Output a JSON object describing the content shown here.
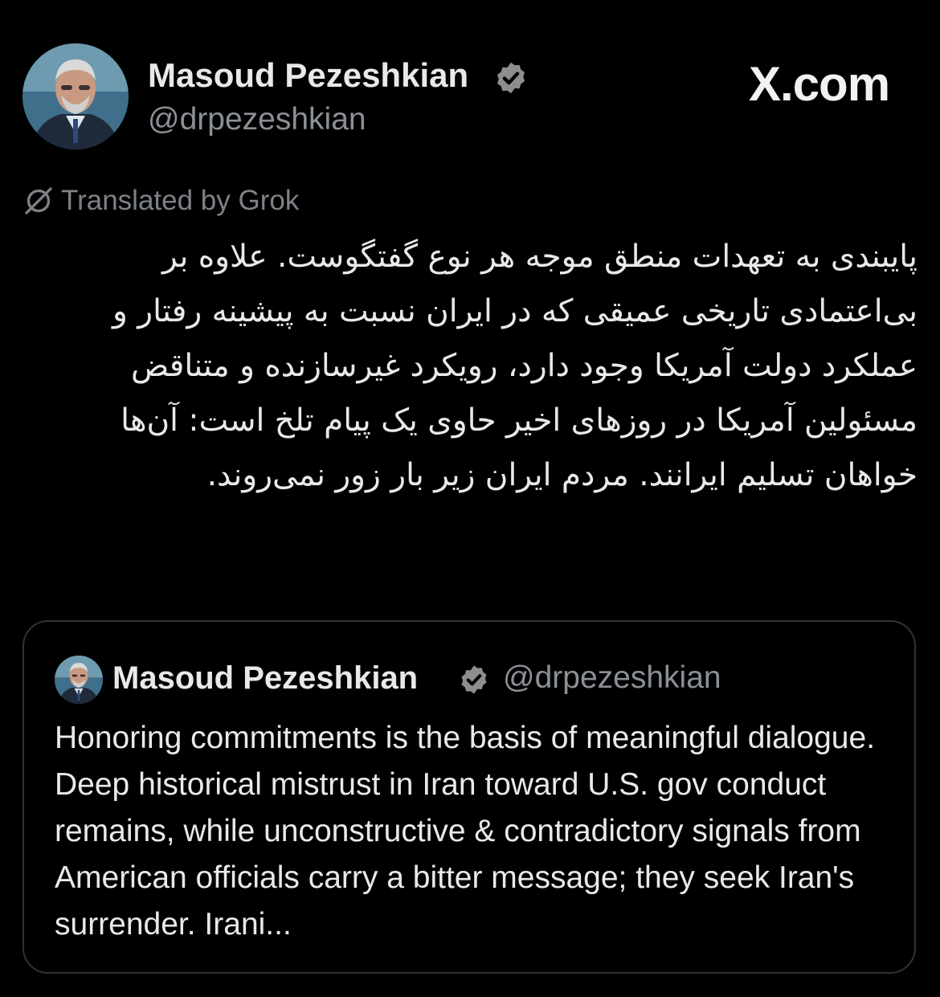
{
  "brand": {
    "label": "X.com"
  },
  "author": {
    "name": "Masoud Pezeshkian",
    "handle": "@drpezeshkian",
    "verified": true
  },
  "translation_note": "Translated by Grok",
  "tweet": {
    "text": "پایبندی به تعهدات منطق موجه هر نوع گفتگوست. علاوه بر بی‌اعتمادی تاریخی عمیقی که در ایران نسبت به پیشینه رفتار و عملکرد دولت آمریکا وجود دارد، رویکرد غیرسازنده و متناقض مسئولین آمریکا در روزهای اخیر حاوی یک پیام تلخ است: آن‌ها خواهان تسلیم ایرانند. مردم ایران زیر بار زور نمی‌روند."
  },
  "quoted_tweet": {
    "name": "Masoud Pezeshkian",
    "handle": "@drpezeshkian",
    "verified": true,
    "text": "Honoring commitments is the basis of meaningful dialogue. Deep historical mistrust in Iran toward U.S. gov conduct remains, while unconstructive & contradictory signals from American officials carry a bitter message; they seek Iran's surrender. Irani..."
  },
  "colors": {
    "background": "#000000",
    "text": "#e7e9ea",
    "secondary_text": "#8b9096",
    "card_border": "#2f3336",
    "verified_badge": "#8e8e8e"
  },
  "icons": {
    "verified": "verified-badge-icon",
    "translate": "translate-icon",
    "avatar": "profile-photo"
  }
}
